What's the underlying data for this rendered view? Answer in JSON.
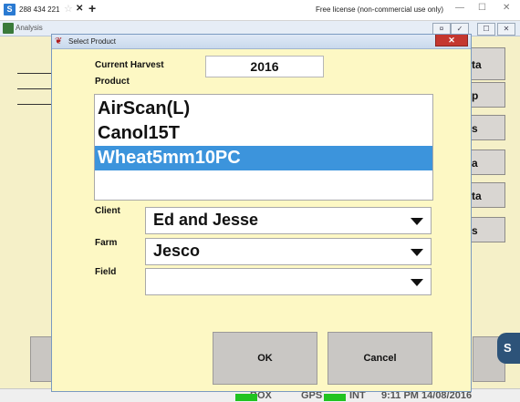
{
  "tabbar": {
    "title": "288 434 221",
    "license": "Free license (non-commercial use only)"
  },
  "bgwindow": {
    "title": "Analysis",
    "side_buttons": [
      "ta",
      "p",
      "s",
      "a",
      "ta",
      "s"
    ]
  },
  "dialog": {
    "title": "Select Product",
    "current_harvest_label": "Current Harvest",
    "current_harvest_value": "2016",
    "product_label": "Product",
    "products": [
      "AirScan(L)",
      "Canol15T",
      "Wheat5mm10PC"
    ],
    "selected_product": "Wheat5mm10PC",
    "client_label": "Client",
    "client_value": "Ed and Jesse",
    "farm_label": "Farm",
    "farm_value": "Jesco",
    "field_label": "Field",
    "field_value": "",
    "ok_label": "OK",
    "cancel_label": "Cancel"
  },
  "statusbar": {
    "box": "BOX",
    "gps": "GPS",
    "int": "INT",
    "datetime": "9:11 PM 14/08/2016"
  },
  "colors": {
    "selection": "#3c94dc",
    "dialog_bg": "#fdf8c4",
    "app_bg": "#f5f0c8",
    "status_ok": "#21c321"
  },
  "icons": [
    "app-icon",
    "star-icon",
    "close-icon",
    "plus-icon",
    "minimize-icon",
    "maximize-icon",
    "dropdown-arrow-icon"
  ]
}
